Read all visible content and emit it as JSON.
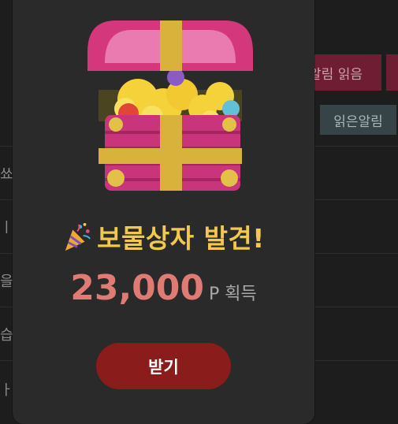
{
  "background": {
    "mark_all_read_label": "알림 읽음",
    "read_notifications_label": "읽은알림",
    "row_fragments": [
      "쑈",
      "ㅣ",
      "을",
      "습",
      "ㅏ."
    ]
  },
  "popup": {
    "title": "보물상자 발견!",
    "points_value": "23,000",
    "points_unit": "P 획득",
    "claim_label": "받기",
    "party_icon": "party-popper-icon",
    "chest_icon": "treasure-chest-icon"
  },
  "colors": {
    "title": "#f2c94c",
    "points": "#e07a75",
    "claim_button": "#8a1c1c",
    "chest_pink": "#d4377c",
    "ribbon_gold": "#d9b23c"
  }
}
